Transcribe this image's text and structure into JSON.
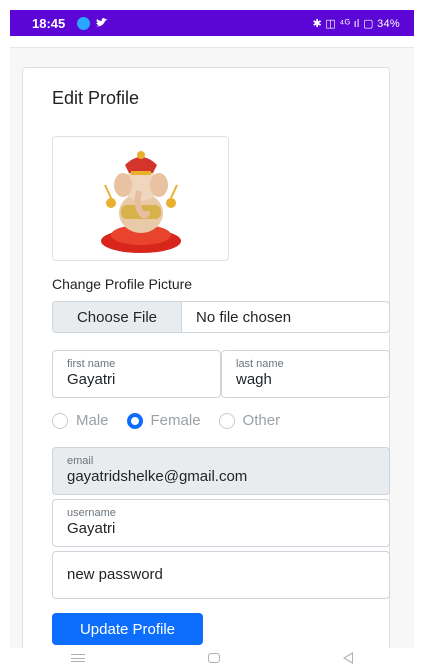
{
  "status_bar": {
    "time": "18:45",
    "right_text": "✱ ◫ ⁴ᴳ ıl ▢ 34%",
    "bg_color": "#5b06d6"
  },
  "card": {
    "title": "Edit Profile",
    "change_picture_label": "Change Profile Picture"
  },
  "file_input": {
    "button_label": "Choose File",
    "status_text": "No file chosen"
  },
  "first_name": {
    "label": "first name",
    "value": "Gayatri"
  },
  "last_name": {
    "label": "last name",
    "value": "wagh"
  },
  "gender": {
    "options": [
      "Male",
      "Female",
      "Other"
    ],
    "selected": "Female"
  },
  "email": {
    "label": "email",
    "value": "gayatridshelke@gmail.com"
  },
  "username": {
    "label": "username",
    "value": "Gayatri"
  },
  "password": {
    "placeholder": "new password"
  },
  "update_button": {
    "label": "Update Profile",
    "color": "#0d6efd"
  }
}
